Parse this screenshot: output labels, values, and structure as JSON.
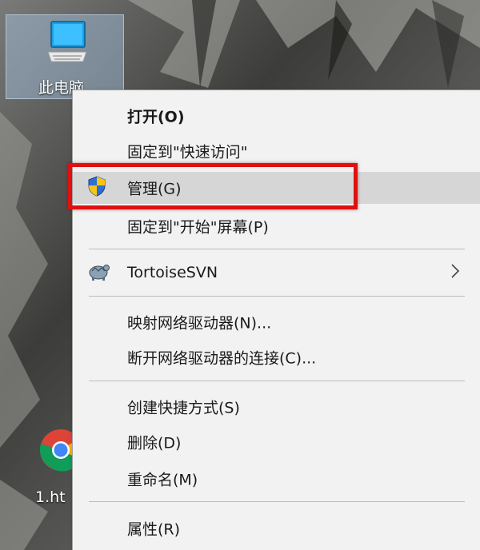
{
  "desktop": {
    "icons": [
      {
        "label": "此电脑",
        "icon": "computer-monitor-icon"
      },
      {
        "label": "1.ht",
        "icon": "chrome-icon"
      }
    ]
  },
  "context_menu": {
    "items": [
      {
        "label": "打开(O)",
        "bold": true
      },
      {
        "label": "固定到\"快速访问\""
      },
      {
        "label": "管理(G)",
        "icon": "uac-shield-icon",
        "hovered": true
      },
      {
        "label": "固定到\"开始\"屏幕(P)"
      },
      {
        "label": "TortoiseSVN",
        "icon": "tortoisesvn-icon",
        "submenu_icon": "chevron-right-icon"
      },
      {
        "label": "映射网络驱动器(N)..."
      },
      {
        "label": "断开网络驱动器的连接(C)..."
      },
      {
        "label": "创建快捷方式(S)"
      },
      {
        "label": "删除(D)"
      },
      {
        "label": "重命名(M)"
      },
      {
        "label": "属性(R)"
      }
    ]
  },
  "colors": {
    "highlight_border": "#e01010",
    "menu_background": "#f2f2f2",
    "hover_background": "#d6d6d6",
    "selection_tint": "#aacdeb"
  }
}
